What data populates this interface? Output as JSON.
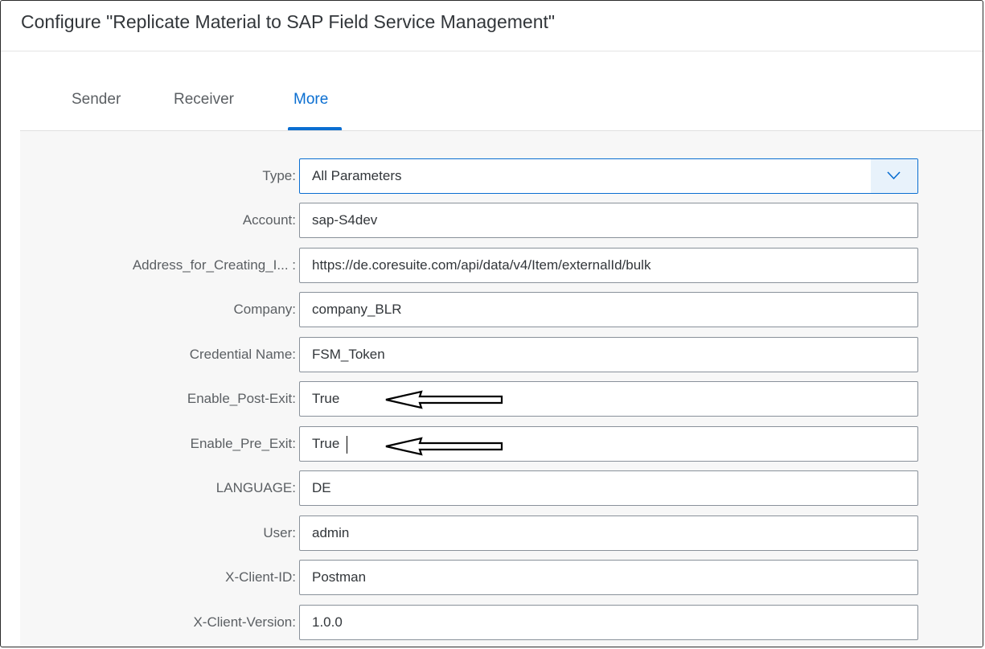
{
  "dialog": {
    "title": "Configure \"Replicate Material to SAP Field Service Management\""
  },
  "tabs": [
    {
      "label": "Sender",
      "active": false
    },
    {
      "label": "Receiver",
      "active": false
    },
    {
      "label": "More",
      "active": true
    }
  ],
  "colors": {
    "accent": "#0a6ed1",
    "label_text": "#5b5f63",
    "field_border": "#89919a",
    "content_bg": "#f7f7f7"
  },
  "parameters": [
    {
      "label": "Type:",
      "value": "All Parameters",
      "kind": "select",
      "icon": "chevron-down-icon"
    },
    {
      "label": "Account:",
      "value": "sap-S4dev"
    },
    {
      "label": "Address_for_Creating_I... :",
      "value": "https://de.coresuite.com/api/data/v4/Item/externalId/bulk"
    },
    {
      "label": "Company:",
      "value": "company_BLR"
    },
    {
      "label": "Credential Name:",
      "value": "FSM_Token"
    },
    {
      "label": "Enable_Post-Exit:",
      "value": "True",
      "annotation": "left-arrow-icon"
    },
    {
      "label": "Enable_Pre_Exit:",
      "value": "True",
      "annotation": "left-arrow-icon"
    },
    {
      "label": "LANGUAGE:",
      "value": "DE"
    },
    {
      "label": "User:",
      "value": "admin"
    },
    {
      "label": "X-Client-ID:",
      "value": "Postman"
    },
    {
      "label": "X-Client-Version:",
      "value": "1.0.0"
    }
  ]
}
